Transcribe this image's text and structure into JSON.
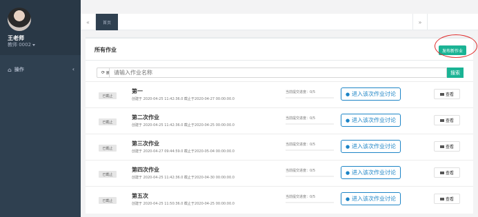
{
  "sidebar": {
    "user_name": "王老师",
    "user_role": "教师 0002",
    "menu_label": "操作"
  },
  "tabs": {
    "left_nav": "«",
    "home": "首页",
    "right_nav": "»"
  },
  "panel": {
    "title": "所有作业",
    "publish_label": "发布新作业",
    "refresh_label": "刷新",
    "search_placeholder": "请输入作业名称",
    "search_label": "搜索"
  },
  "assignments": [
    {
      "status": "已截止",
      "name": "第一",
      "meta": "创建于 2020-04-25 11:42:36.0 截止于2020-04-27 00:00:00.0",
      "progress": "当前提交进度：0/5",
      "discuss": "进入该次作业讨论",
      "view": "查看"
    },
    {
      "status": "已截止",
      "name": "第二次作业",
      "meta": "创建于 2020-04-25 11:42:36.0 截止于2020-04-25 00:00:00.0",
      "progress": "当前提交进度：0/5",
      "discuss": "进入该次作业讨论",
      "view": "查看"
    },
    {
      "status": "已截止",
      "name": "第三次作业",
      "meta": "创建于 2020-04-27 09:44:59.0 截止于2020-05-04 00:00:00.0",
      "progress": "当前提交进度：0/5",
      "discuss": "进入该次作业讨论",
      "view": "查看"
    },
    {
      "status": "已截止",
      "name": "第四次作业",
      "meta": "创建于 2020-04-25 11:42:36.0 截止于2020-04-30 00:00:00.0",
      "progress": "当前提交进度：0/5",
      "discuss": "进入该次作业讨论",
      "view": "查看"
    },
    {
      "status": "已截止",
      "name": "第五次",
      "meta": "创建于 2020-04-25 11:50:36.0 截止于2020-04-25 00:00:00.0",
      "progress": "当前提交进度：0/5",
      "discuss": "进入该次作业讨论",
      "view": "查看"
    }
  ],
  "colors": {
    "sidebar": "#2f4050",
    "accent": "#1ab394",
    "link": "#1c84c6",
    "annotation": "#e02a2a"
  }
}
